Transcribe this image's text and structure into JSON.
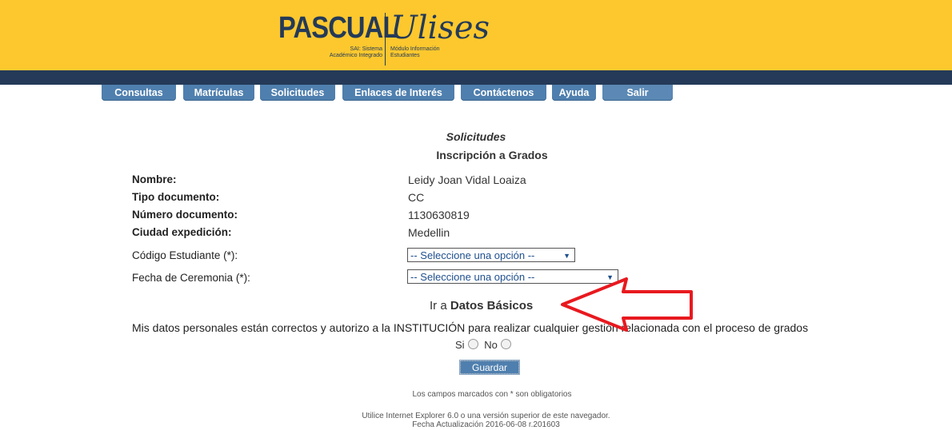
{
  "header": {
    "brand": "PASCUAL",
    "brand_sub": "SAI: Sistema\nAcadémico Integrado",
    "product": "Ulises",
    "product_sub": "Módulo Información\nEstudiantes"
  },
  "nav": {
    "tabs": [
      {
        "label": "Consultas"
      },
      {
        "label": "Matrículas"
      },
      {
        "label": "Solicitudes"
      },
      {
        "label": "Enlaces de Interés"
      },
      {
        "label": "Contáctenos"
      },
      {
        "label": "Ayuda"
      },
      {
        "label": "Salir"
      }
    ]
  },
  "page": {
    "title": "Solicitudes",
    "subtitle": "Inscripción a Grados"
  },
  "student": {
    "nombre_label": "Nombre:",
    "nombre_value": "Leidy Joan Vidal Loaiza",
    "tipo_doc_label": "Tipo documento:",
    "tipo_doc_value": "CC",
    "numero_doc_label": "Número documento:",
    "numero_doc_value": "1130630819",
    "ciudad_label": "Ciudad expedición:",
    "ciudad_value": "Medellin"
  },
  "form": {
    "codigo_label": "Código Estudiante (*):",
    "codigo_selected": "-- Seleccione una opción --",
    "fecha_label": "Fecha de Ceremonia (*):",
    "fecha_selected": "-- Seleccione una opción --",
    "ir_prefix": "Ir a ",
    "ir_link": "Datos Básicos",
    "authorize_text": "Mis datos personales están correctos y autorizo a la INSTITUCIÓN para realizar cualquier gestión relacionada con el proceso de grados",
    "si_label": "Si",
    "no_label": "No",
    "save_label": "Guardar"
  },
  "notes": {
    "required": "Los campos marcados con * son obligatorios",
    "browser": "Utilice Internet Explorer 6.0 o una versión superior de este navegador.",
    "updated": "Fecha Actualización 2016-06-08 r.201603"
  },
  "colors": {
    "header_yellow": "#fcc82e",
    "navy": "#243a58",
    "tab_blue": "#4f7fae",
    "annotation_red": "#e8191f"
  }
}
